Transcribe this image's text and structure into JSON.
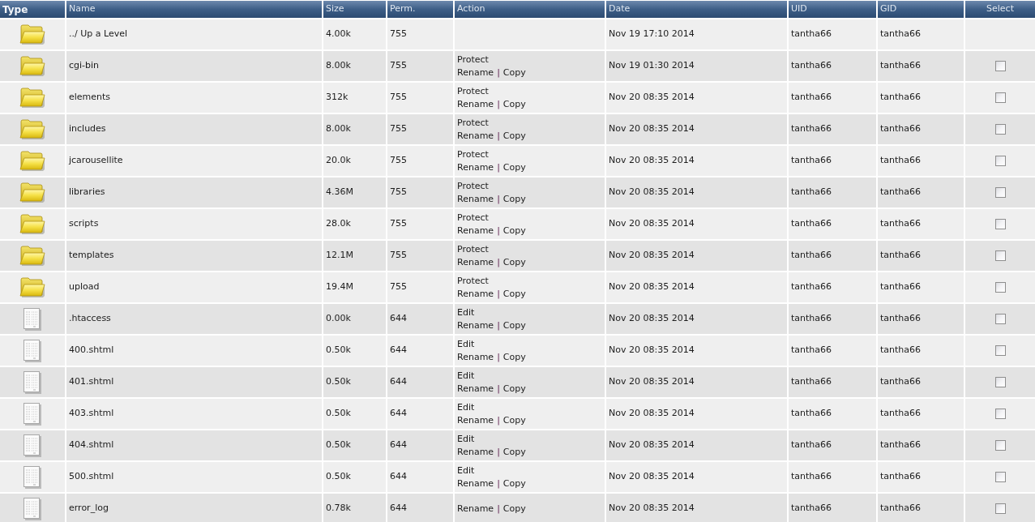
{
  "columns": [
    {
      "label": "Type",
      "bold": true
    },
    {
      "label": "Name",
      "bold": false
    },
    {
      "label": "Size",
      "bold": false
    },
    {
      "label": "Perm.",
      "bold": false
    },
    {
      "label": "Action",
      "bold": false
    },
    {
      "label": "Date",
      "bold": false
    },
    {
      "label": "UID",
      "bold": false
    },
    {
      "label": "GID",
      "bold": false
    },
    {
      "label": "Select",
      "bold": false
    }
  ],
  "action_separator": "|",
  "rows": [
    {
      "kind": "folder",
      "name": "../ Up a Level",
      "size": "4.00k",
      "perm": "755",
      "date": "Nov 19 17:10 2014",
      "uid": "tantha66",
      "gid": "tantha66"
    },
    {
      "kind": "folder",
      "name": "cgi-bin",
      "size": "8.00k",
      "perm": "755",
      "actions": [
        [
          "Protect"
        ],
        [
          "Rename",
          "Copy"
        ]
      ],
      "date": "Nov 19 01:30 2014",
      "uid": "tantha66",
      "gid": "tantha66",
      "checked": false
    },
    {
      "kind": "folder",
      "name": "elements",
      "size": "312k",
      "perm": "755",
      "actions": [
        [
          "Protect"
        ],
        [
          "Rename",
          "Copy"
        ]
      ],
      "date": "Nov 20 08:35 2014",
      "uid": "tantha66",
      "gid": "tantha66",
      "checked": false
    },
    {
      "kind": "folder",
      "name": "includes",
      "size": "8.00k",
      "perm": "755",
      "actions": [
        [
          "Protect"
        ],
        [
          "Rename",
          "Copy"
        ]
      ],
      "date": "Nov 20 08:35 2014",
      "uid": "tantha66",
      "gid": "tantha66",
      "checked": false
    },
    {
      "kind": "folder",
      "name": "jcarousellite",
      "size": "20.0k",
      "perm": "755",
      "actions": [
        [
          "Protect"
        ],
        [
          "Rename",
          "Copy"
        ]
      ],
      "date": "Nov 20 08:35 2014",
      "uid": "tantha66",
      "gid": "tantha66",
      "checked": false
    },
    {
      "kind": "folder",
      "name": "libraries",
      "size": "4.36M",
      "perm": "755",
      "actions": [
        [
          "Protect"
        ],
        [
          "Rename",
          "Copy"
        ]
      ],
      "date": "Nov 20 08:35 2014",
      "uid": "tantha66",
      "gid": "tantha66",
      "checked": false
    },
    {
      "kind": "folder",
      "name": "scripts",
      "size": "28.0k",
      "perm": "755",
      "actions": [
        [
          "Protect"
        ],
        [
          "Rename",
          "Copy"
        ]
      ],
      "date": "Nov 20 08:35 2014",
      "uid": "tantha66",
      "gid": "tantha66",
      "checked": false
    },
    {
      "kind": "folder",
      "name": "templates",
      "size": "12.1M",
      "perm": "755",
      "actions": [
        [
          "Protect"
        ],
        [
          "Rename",
          "Copy"
        ]
      ],
      "date": "Nov 20 08:35 2014",
      "uid": "tantha66",
      "gid": "tantha66",
      "checked": false
    },
    {
      "kind": "folder",
      "name": "upload",
      "size": "19.4M",
      "perm": "755",
      "actions": [
        [
          "Protect"
        ],
        [
          "Rename",
          "Copy"
        ]
      ],
      "date": "Nov 20 08:35 2014",
      "uid": "tantha66",
      "gid": "tantha66",
      "checked": false
    },
    {
      "kind": "file",
      "name": ".htaccess",
      "size": "0.00k",
      "perm": "644",
      "actions": [
        [
          "Edit"
        ],
        [
          "Rename",
          "Copy"
        ]
      ],
      "date": "Nov 20 08:35 2014",
      "uid": "tantha66",
      "gid": "tantha66",
      "checked": false
    },
    {
      "kind": "file",
      "name": "400.shtml",
      "size": "0.50k",
      "perm": "644",
      "actions": [
        [
          "Edit"
        ],
        [
          "Rename",
          "Copy"
        ]
      ],
      "date": "Nov 20 08:35 2014",
      "uid": "tantha66",
      "gid": "tantha66",
      "checked": false
    },
    {
      "kind": "file",
      "name": "401.shtml",
      "size": "0.50k",
      "perm": "644",
      "actions": [
        [
          "Edit"
        ],
        [
          "Rename",
          "Copy"
        ]
      ],
      "date": "Nov 20 08:35 2014",
      "uid": "tantha66",
      "gid": "tantha66",
      "checked": false
    },
    {
      "kind": "file",
      "name": "403.shtml",
      "size": "0.50k",
      "perm": "644",
      "actions": [
        [
          "Edit"
        ],
        [
          "Rename",
          "Copy"
        ]
      ],
      "date": "Nov 20 08:35 2014",
      "uid": "tantha66",
      "gid": "tantha66",
      "checked": false
    },
    {
      "kind": "file",
      "name": "404.shtml",
      "size": "0.50k",
      "perm": "644",
      "actions": [
        [
          "Edit"
        ],
        [
          "Rename",
          "Copy"
        ]
      ],
      "date": "Nov 20 08:35 2014",
      "uid": "tantha66",
      "gid": "tantha66",
      "checked": false
    },
    {
      "kind": "file",
      "name": "500.shtml",
      "size": "0.50k",
      "perm": "644",
      "actions": [
        [
          "Edit"
        ],
        [
          "Rename",
          "Copy"
        ]
      ],
      "date": "Nov 20 08:35 2014",
      "uid": "tantha66",
      "gid": "tantha66",
      "checked": false
    },
    {
      "kind": "file",
      "name": "error_log",
      "size": "0.78k",
      "perm": "644",
      "actions": [
        [
          "Rename",
          "Copy"
        ]
      ],
      "date": "Nov 20 08:35 2014",
      "uid": "tantha66",
      "gid": "tantha66",
      "checked": false
    }
  ]
}
